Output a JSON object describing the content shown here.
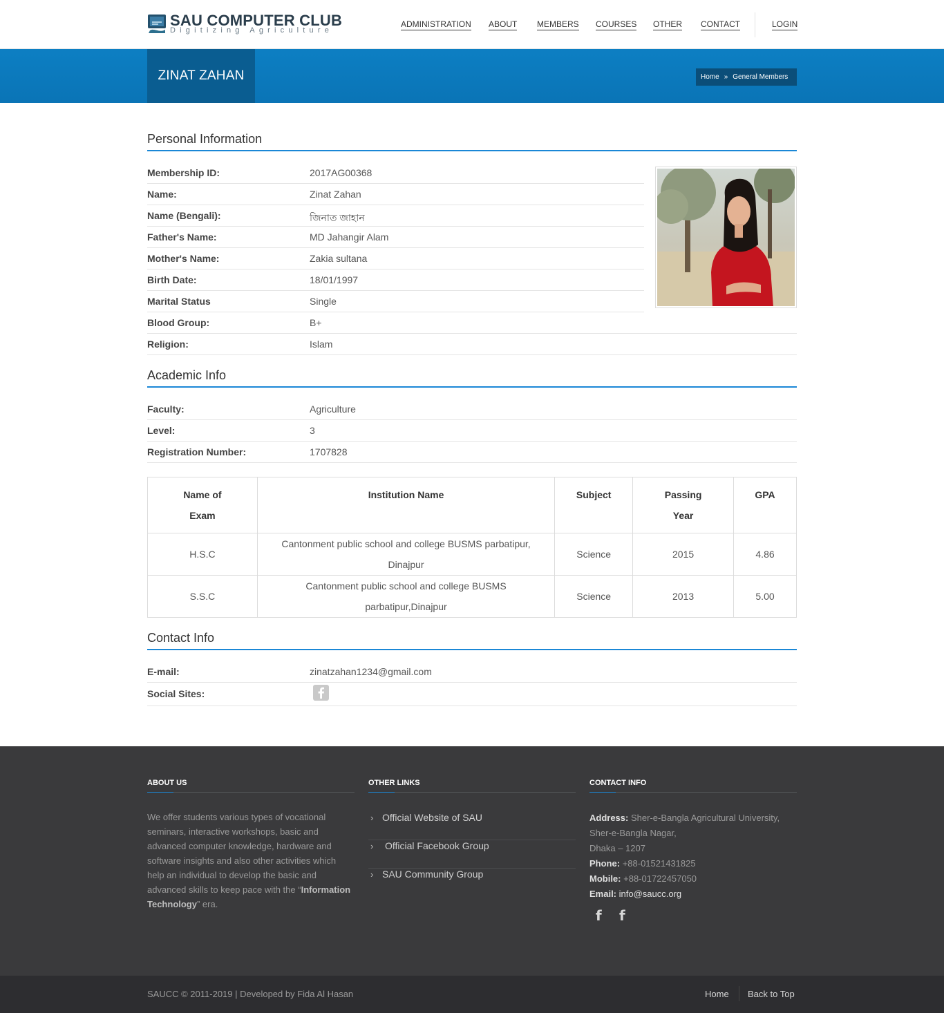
{
  "header": {
    "logo_title": "SAU COMPUTER CLUB",
    "logo_subtitle": "Digitizing Agriculture",
    "nav": [
      "ADMINISTRATION",
      "ABOUT",
      "MEMBERS",
      "COURSES",
      "OTHER",
      "CONTACT"
    ],
    "login": "LOGIN"
  },
  "title_bar": {
    "title": "ZINAT ZAHAN",
    "breadcrumb": [
      "Home",
      "General Members"
    ],
    "breadcrumb_sep": "»"
  },
  "personal": {
    "heading": "Personal Information",
    "rows": [
      {
        "label": "Membership ID:",
        "value": "2017AG00368"
      },
      {
        "label": "Name:",
        "value": "Zinat Zahan"
      },
      {
        "label": "Name (Bengali):",
        "value": "জিনাত জাহান"
      },
      {
        "label": "Father's Name:",
        "value": "MD Jahangir Alam"
      },
      {
        "label": "Mother's Name:",
        "value": "Zakia sultana"
      },
      {
        "label": "Birth Date:",
        "value": "18/01/1997"
      },
      {
        "label": "Marital Status",
        "value": "Single"
      },
      {
        "label": "Blood Group:",
        "value": "B+"
      },
      {
        "label": "Religion:",
        "value": "Islam"
      }
    ]
  },
  "academic": {
    "heading": "Academic Info",
    "rows": [
      {
        "label": "Faculty:",
        "value": "Agriculture"
      },
      {
        "label": "Level:",
        "value": "3"
      },
      {
        "label": "Registration Number:",
        "value": "1707828"
      }
    ],
    "table": {
      "headers": [
        "Name of Exam",
        "Institution Name",
        "Subject",
        "Passing Year",
        "GPA"
      ],
      "rows": [
        [
          "H.S.C",
          "Cantonment public school and college BUSMS parbatipur, Dinajpur",
          "Science",
          "2015",
          "4.86"
        ],
        [
          "S.S.C",
          "Cantonment public school and college BUSMS parbatipur,Dinajpur",
          "Science",
          "2013",
          "5.00"
        ]
      ]
    }
  },
  "contact": {
    "heading": "Contact Info",
    "email_label": "E-mail:",
    "email": "zinatzahan1234@gmail.com",
    "social_label": "Social Sites:"
  },
  "footer": {
    "about_title": "ABOUT US",
    "about_text_before": "We offer students various types of vocational seminars, interactive workshops, basic and advanced computer knowledge, hardware and software insights and also other activities which help an individual to develop the basic and advanced skills to keep pace with the “",
    "about_text_bold": "Information Technology",
    "about_text_after": "” era.",
    "links_title": "OTHER LINKS",
    "links": [
      "Official Website of SAU",
      "Official Facebook Group",
      "SAU Community Group"
    ],
    "contact_title": "CONTACT INFO",
    "address_label": "Address:",
    "address_line1": "Sher-e-Bangla Agricultural University,",
    "address_line2": "Sher-e-Bangla Nagar,",
    "address_line3": "Dhaka – 1207",
    "phone_label": "Phone:",
    "phone": "+88-01521431825",
    "mobile_label": "Mobile:",
    "mobile": "+88-01722457050",
    "email_label": "Email:",
    "email": "info@saucc.org",
    "social_glyph": "f"
  },
  "bottom": {
    "copyright": "SAUCC © 2011-2019 | Developed by Fida Al Hasan",
    "home": "Home",
    "back_to_top": "Back to Top"
  },
  "colors": {
    "accent": "#1a87d6",
    "title_bar": "#0b7abf",
    "title_box": "#0a5d91",
    "footer": "#3a3a3c"
  }
}
